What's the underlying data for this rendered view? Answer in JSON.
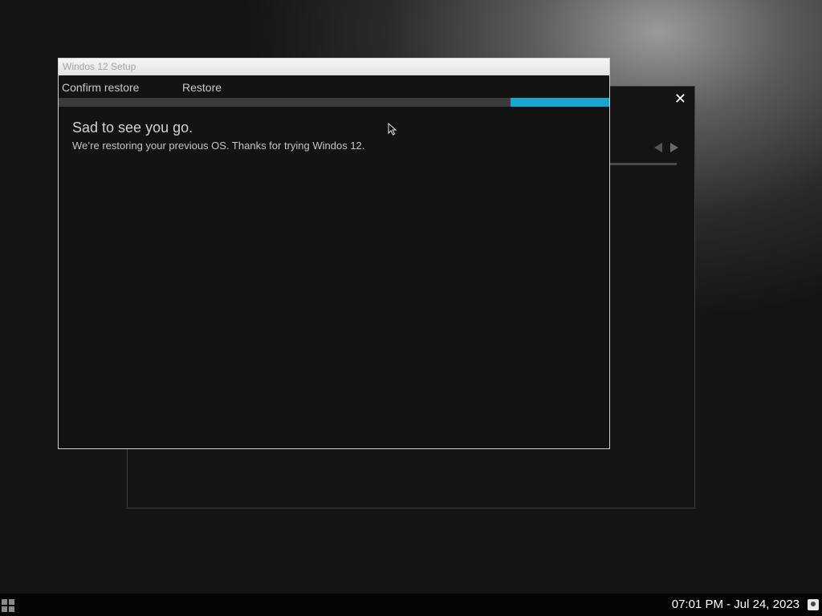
{
  "background_window": {
    "close_symbol": "✕"
  },
  "dialog": {
    "title": "Windos 12 Setup",
    "steps": [
      "Confirm restore",
      "Restore"
    ],
    "progress": {
      "current_step": 2,
      "total_steps": 2,
      "accent": "#1ba6cf"
    },
    "heading": "Sad to see you go.",
    "message": "We’re restoring your previous OS. Thanks for trying Windos 12."
  },
  "taskbar": {
    "start_icon": "windows-grid-icon",
    "clock": "07:01 PM - Jul 24, 2023",
    "tray_icon": "user-icon"
  }
}
